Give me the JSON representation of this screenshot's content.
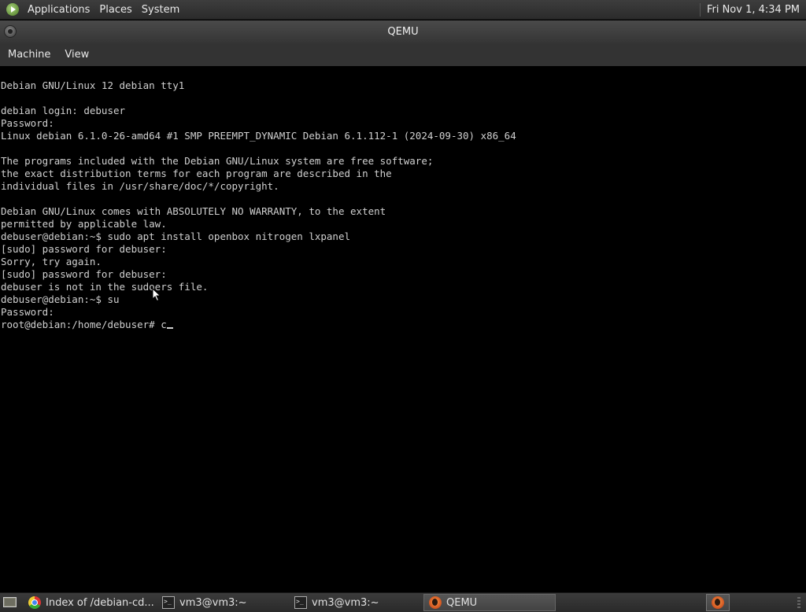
{
  "top_panel": {
    "menus": [
      "Applications",
      "Places",
      "System"
    ],
    "clock": "Fri Nov 1,  4:34 PM"
  },
  "window": {
    "title": "QEMU"
  },
  "menubar": {
    "items": [
      "Machine",
      "View"
    ]
  },
  "console": {
    "lines": [
      "Debian GNU/Linux 12 debian tty1",
      "",
      "debian login: debuser",
      "Password:",
      "Linux debian 6.1.0-26-amd64 #1 SMP PREEMPT_DYNAMIC Debian 6.1.112-1 (2024-09-30) x86_64",
      "",
      "The programs included with the Debian GNU/Linux system are free software;",
      "the exact distribution terms for each program are described in the",
      "individual files in /usr/share/doc/*/copyright.",
      "",
      "Debian GNU/Linux comes with ABSOLUTELY NO WARRANTY, to the extent",
      "permitted by applicable law.",
      "debuser@debian:~$ sudo apt install openbox nitrogen lxpanel",
      "[sudo] password for debuser:",
      "Sorry, try again.",
      "[sudo] password for debuser:",
      "debuser is not in the sudoers file.",
      "debuser@debian:~$ su",
      "Password:"
    ],
    "prompt": "root@debian:/home/debuser# c"
  },
  "taskbar": {
    "tasks": [
      {
        "label": "Index of /debian-cd...",
        "icon": "browser-icon",
        "active": false
      },
      {
        "label": "vm3@vm3:~",
        "icon": "terminal-icon",
        "active": false
      },
      {
        "label": "vm3@vm3:~",
        "icon": "terminal-icon",
        "active": false
      },
      {
        "label": "QEMU",
        "icon": "qemu-icon",
        "active": true
      }
    ]
  },
  "colors": {
    "panel": "#2f2f2f",
    "console_bg": "#000000",
    "console_fg": "#d0d0d0"
  }
}
